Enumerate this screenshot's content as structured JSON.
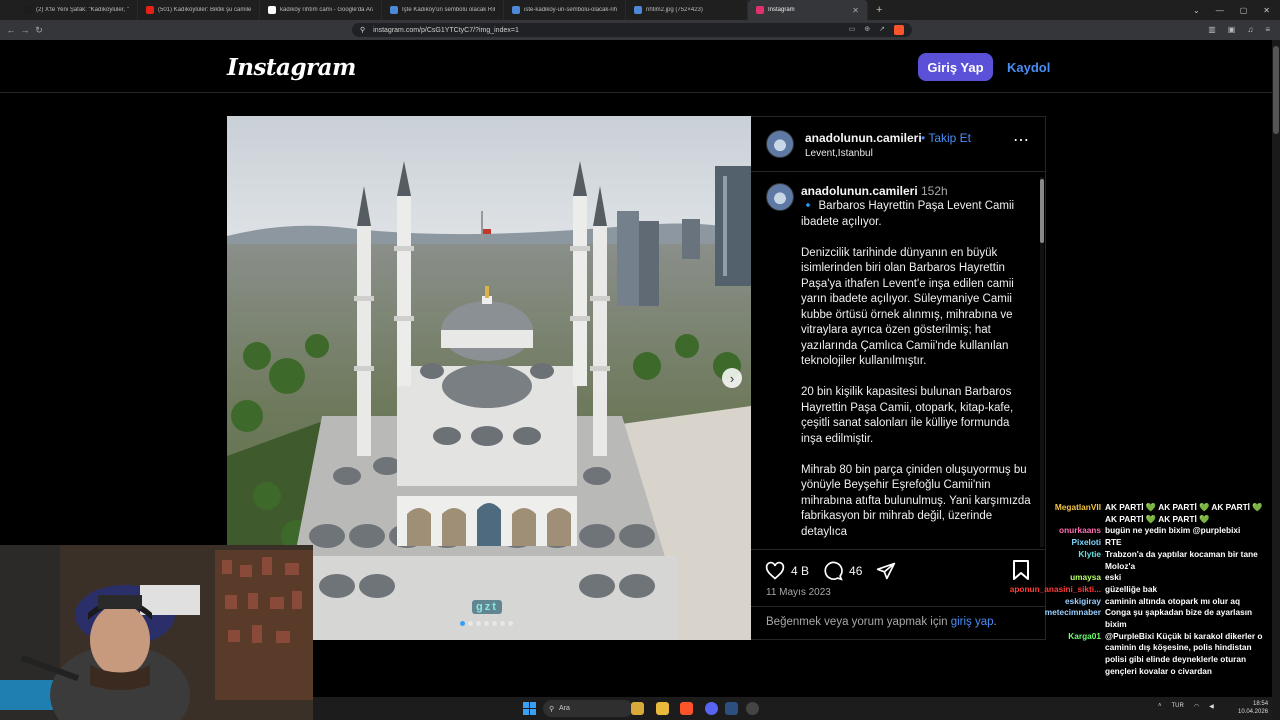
{
  "browser": {
    "tabs": [
      {
        "label": "(2) X'te Yeni Şafak: \"Kadıköylüler, \"Rıh",
        "color": "#1d1d1d"
      },
      {
        "label": "(501) Kadıköylüler: Biktik şu camilerd",
        "color": "#e62117"
      },
      {
        "label": "kadıköy rıhtım cami - Google'da Ara",
        "color": "#ffffff"
      },
      {
        "label": "İşte Kadıköy'ün sembolü olacak Rıht",
        "color": "#4d89d6"
      },
      {
        "label": "iste-kadikoy-un-sembolu-olacak-rih",
        "color": "#4d89d6"
      },
      {
        "label": "rihtim2.jpg (752×423)",
        "color": "#4d89d6"
      },
      {
        "label": "Instagram",
        "color": "#e1306c",
        "active": true
      }
    ],
    "new_tab": "+",
    "url": "instagram.com/p/CsG1YTCtyC7/?img_index=1"
  },
  "header": {
    "logo": "Instagram",
    "login_button": "Giriş Yap",
    "signup_link": "Kaydol"
  },
  "post": {
    "username": "anadolunun.camileri",
    "follow_label": "Takip Et",
    "location": "Levent,Istanbul",
    "more_icon": "⋯",
    "caption_user": "anadolunun.camileri",
    "caption_time": "152h",
    "caption_text": "🔹 Barbaros Hayrettin Paşa Levent Camii ibadete açılıyor.\n\nDenizcilik tarihinde dünyanın en büyük isimlerinden biri olan Barbaros Hayrettin Paşa'ya ithafen Levent'e inşa edilen camii yarın ibadete açılıyor. Süleymaniye Camii kubbe örtüsü örnek alınmış, mihrabına ve vitraylara ayrıca özen gösterilmiş; hat yazılarında Çamlıca Camii'nde kullanılan teknolojiler kullanılmıştır.\n\n20 bin kişilik kapasitesi bulunan Barbaros Hayrettin Paşa Camii, otopark, kitap-kafe, çeşitli sanat salonları ile külliye formunda inşa edilmiştir.\n\nMihrab 80 bin parça çiniden oluşuyormuş bu yönüyle Beyşehir Eşrefoğlu Camii'nin mihrabına atıfta bulunulmuş. Yani karşımızda fabrikasyon bir mihrab değil, üzerinde detaylıca",
    "likes": "4 B",
    "comments": "46",
    "date": "11 Mayıs 2023",
    "login_prompt_before": "Beğenmek veya yorum yapmak için ",
    "login_prompt_link": "giriş yap",
    "login_prompt_after": ".",
    "watermark": "gzt",
    "carousel_count": 7,
    "carousel_index": 1
  },
  "chat": [
    {
      "user": "MegatlanVII",
      "color": "#f4c542",
      "text": "AK PARTİ 💚 AK PARTİ 💚 AK PARTİ 💚 AK PARTİ 💚 AK PARTİ 💚"
    },
    {
      "user": "onurkaans",
      "color": "#ff6fb5",
      "text": "bugün ne yedin bixim @purplebixi"
    },
    {
      "user": "Pixeloti",
      "color": "#7fd7ff",
      "text": "RTE"
    },
    {
      "user": "Klytie",
      "color": "#66e0e0",
      "text": "Trabzon'a da yaptılar kocaman bir tane Moloz'a"
    },
    {
      "user": "umaysa",
      "color": "#b7ff6a",
      "text": "eski"
    },
    {
      "user": "aponun_anasini_sikti...",
      "color": "#ff3b3b",
      "text": "güzelliğe bak"
    },
    {
      "user": "eskigiray",
      "color": "#9ad0ff",
      "text": "caminin altında otopark mı olur aq"
    },
    {
      "user": "metecimnaber",
      "color": "#9ad0ff",
      "text": "Conga şu şapkadan bize de ayarlasın bixim"
    },
    {
      "user": "Karga01",
      "color": "#6dff6d",
      "text": "@PurpleBixi Küçük bi karakol dikerler o caminin dış köşesine, polis hindistan polisi gibi elinde deyneklerle oturan gençleri kovalar o civardan"
    }
  ],
  "taskbar": {
    "search_placeholder": "Ara",
    "language": "TUR",
    "time": "18:54",
    "date": "10.04.2026"
  }
}
